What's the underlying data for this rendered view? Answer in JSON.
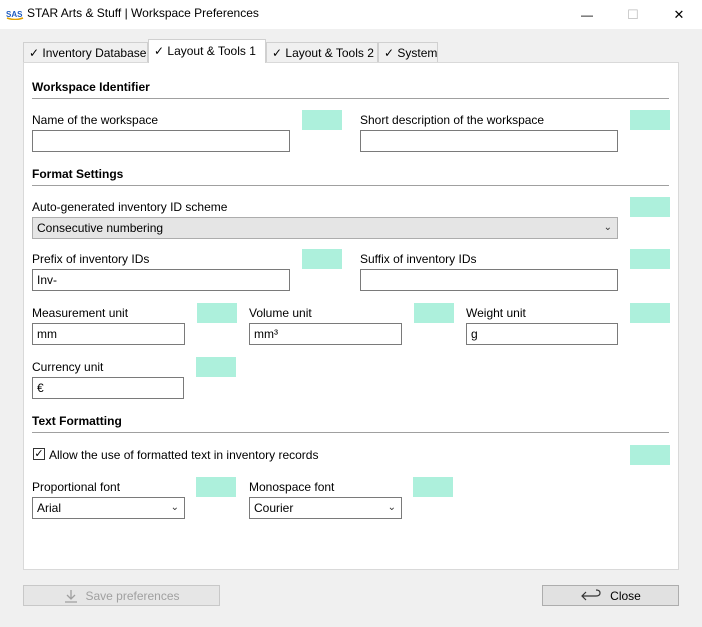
{
  "window": {
    "title": "STAR Arts & Stuff | Workspace Preferences",
    "app_icon_text": "SAS",
    "minimize_glyph": "—",
    "maximize_glyph": "☐",
    "close_glyph": "✕"
  },
  "tabs": [
    {
      "label": "✓ Inventory Database"
    },
    {
      "label": "✓ Layout & Tools 1",
      "active": true
    },
    {
      "label": "✓ Layout & Tools 2"
    },
    {
      "label": "✓ System"
    }
  ],
  "sections": {
    "workspace_identifier": "Workspace Identifier",
    "format_settings": "Format Settings",
    "text_formatting": "Text Formatting"
  },
  "fields": {
    "workspace_name": {
      "label": "Name of the workspace",
      "value": ""
    },
    "short_description": {
      "label": "Short description of the workspace",
      "value": ""
    },
    "id_scheme": {
      "label": "Auto-generated inventory ID scheme",
      "value": "Consecutive numbering"
    },
    "prefix": {
      "label": "Prefix of inventory IDs",
      "value": "Inv-"
    },
    "suffix": {
      "label": "Suffix of inventory IDs",
      "value": ""
    },
    "measurement_unit": {
      "label": "Measurement unit",
      "value": "mm"
    },
    "volume_unit": {
      "label": "Volume unit",
      "value": "mm³"
    },
    "weight_unit": {
      "label": "Weight unit",
      "value": "g"
    },
    "currency_unit": {
      "label": "Currency unit",
      "value": "€"
    },
    "allow_formatted": {
      "label": "Allow the use of formatted text in inventory records",
      "checked": true
    },
    "proportional_font": {
      "label": "Proportional font",
      "value": "Arial"
    },
    "monospace_font": {
      "label": "Monospace font",
      "value": "Courier"
    }
  },
  "buttons": {
    "save": "Save preferences",
    "close": "Close"
  },
  "colors": {
    "swatch": "#adf0dc"
  },
  "icons": {
    "save": "save-down-arrow-icon",
    "close": "return-arrow-icon"
  }
}
